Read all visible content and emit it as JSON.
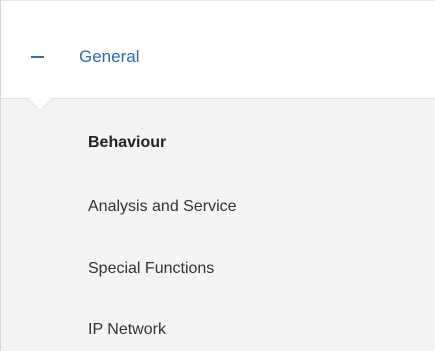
{
  "section": {
    "title": "General",
    "collapse_icon": "minus-icon",
    "accent_color": "#2a6cb0"
  },
  "nav": {
    "items": [
      {
        "label": "Behaviour",
        "active": true
      },
      {
        "label": "Analysis and Service",
        "active": false
      },
      {
        "label": "Special Functions",
        "active": false
      },
      {
        "label": "IP Network",
        "active": false
      }
    ]
  }
}
